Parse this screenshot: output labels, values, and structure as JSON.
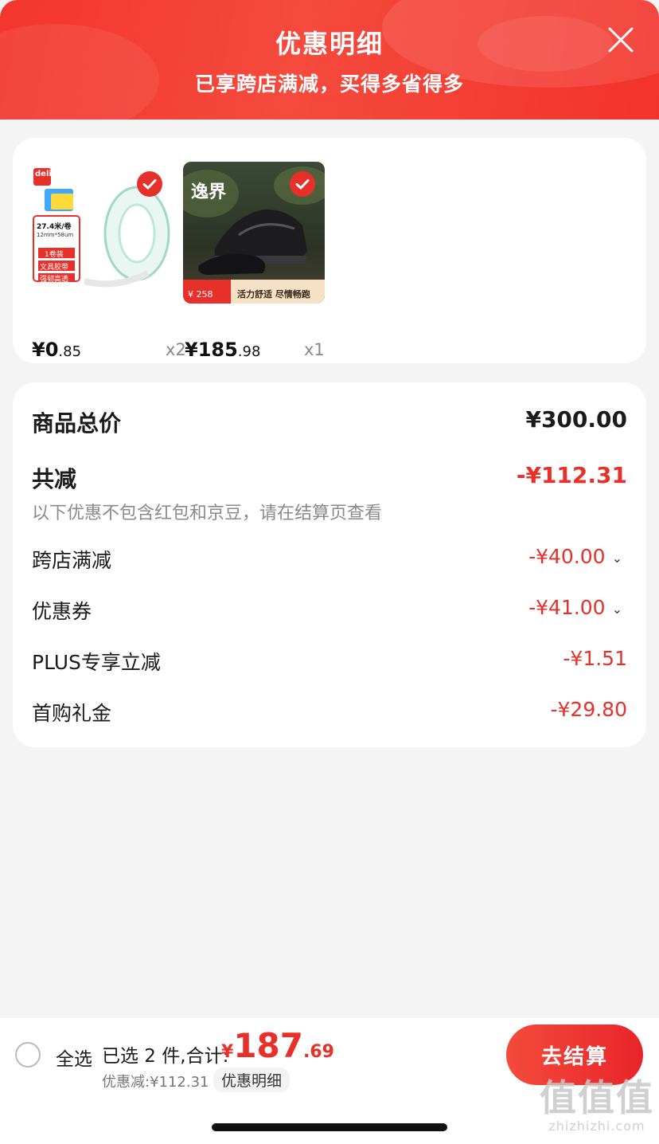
{
  "header": {
    "title": "优惠明细",
    "subtitle": "已享跨店满减，买得多省得多"
  },
  "products": [
    {
      "image_brand": "deli",
      "image_lines": [
        "27.4米/卷",
        "12mm*58um",
        "1卷装",
        "文具胶带",
        "强韧高透"
      ],
      "price_int": "¥0",
      "price_dec": ".85",
      "qty": "x2",
      "selected": true
    },
    {
      "image_title": "逸界",
      "image_badge_price": "258",
      "image_slogan": "活力舒适 尽情畅跑",
      "price_int": "¥185",
      "price_dec": ".98",
      "qty": "x1",
      "selected": true
    }
  ],
  "summary": {
    "total_label": "商品总价",
    "total_value": "¥300.00",
    "reduce_label": "共减",
    "reduce_value": "-¥112.31",
    "note": "以下优惠不包含红包和京豆，请在结算页查看",
    "items": [
      {
        "label": "跨店满减",
        "value": "-¥40.00",
        "expandable": true
      },
      {
        "label": "优惠券",
        "value": "-¥41.00",
        "expandable": true
      },
      {
        "label": "PLUS专享立减",
        "value": "-¥1.51",
        "expandable": false
      },
      {
        "label": "首购礼金",
        "value": "-¥29.80",
        "expandable": false
      }
    ]
  },
  "bottom_bar": {
    "select_all": "全选",
    "selected_count": "已选 2 件,合计:",
    "total_currency": "¥",
    "total_int": "187",
    "total_dec": ".69",
    "discount_text": "优惠减:¥112.31",
    "detail_button": "优惠明细",
    "checkout_button": "去结算"
  },
  "watermark": {
    "logo": "值值值",
    "url": "zhizhizhi.com"
  },
  "colors": {
    "accent": "#e8302a",
    "header": "#f3362f",
    "background": "#f4f4f4"
  },
  "icons": {
    "close": "close-icon",
    "check": "check-icon",
    "chevron": "chevron-down-icon"
  }
}
